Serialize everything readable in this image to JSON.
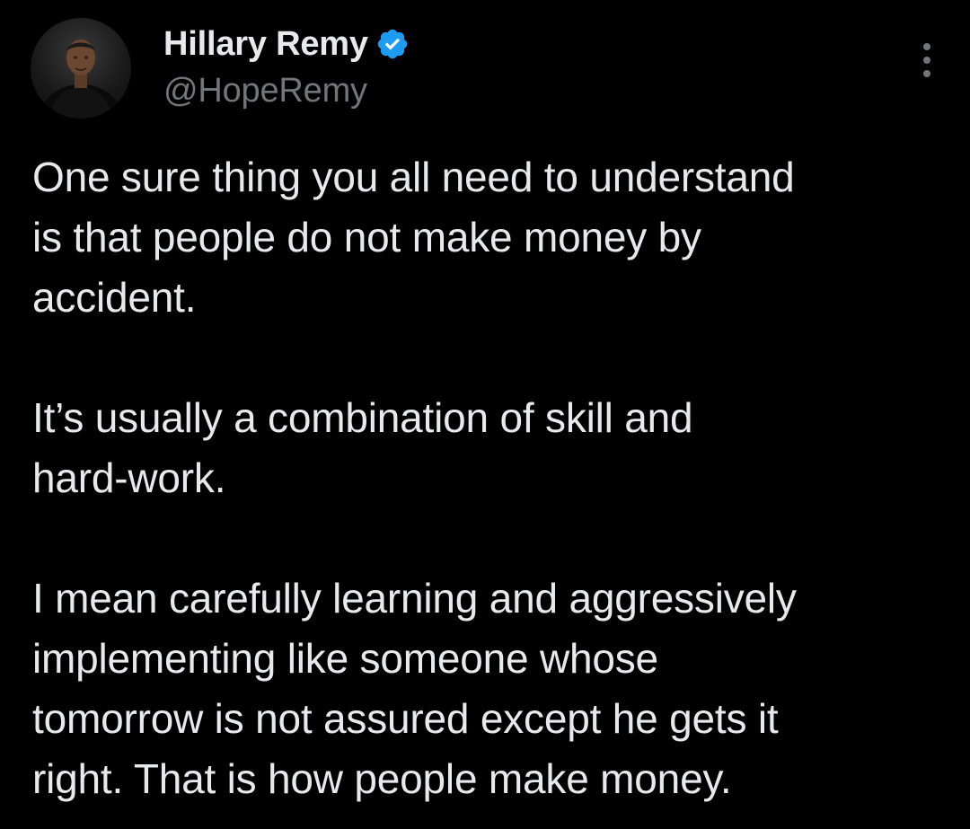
{
  "author": {
    "display_name": "Hillary Remy",
    "handle": "@HopeRemy",
    "verified": true,
    "verified_icon": "verified-badge-icon",
    "avatar_icon": "profile-photo"
  },
  "menu": {
    "icon": "more-options-icon"
  },
  "tweet": {
    "paragraphs": [
      {
        "lines": [
          "One sure thing you all need to understand",
          "is that people do not make money by",
          "accident."
        ]
      },
      {
        "lines": [
          "It’s usually a combination of skill and",
          "hard-work."
        ]
      },
      {
        "lines": [
          "I mean carefully learning and aggressively",
          "implementing like someone whose",
          "tomorrow is not assured except he gets it",
          "right. That is how people make money."
        ]
      }
    ]
  },
  "colors": {
    "background": "#000000",
    "text_primary": "#e7e9ea",
    "text_secondary": "#71767b",
    "verified_blue": "#1d9bf0"
  }
}
